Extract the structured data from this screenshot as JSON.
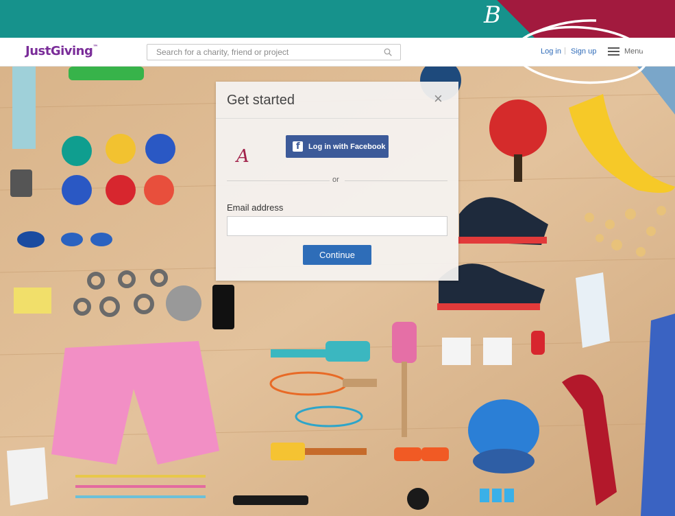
{
  "annotations": {
    "letter_b": "B",
    "letter_a": "A"
  },
  "header": {
    "logo": "JustGiving",
    "logo_tm": "™",
    "search_placeholder": "Search for a charity, friend or project",
    "login": "Log in",
    "separator": "|",
    "signup": "Sign up",
    "menu": "Menu"
  },
  "modal": {
    "title": "Get started",
    "close": "×",
    "facebook_button": "Log in with Facebook",
    "or": "or",
    "email_label": "Email address",
    "email_value": "",
    "continue_button": "Continue"
  },
  "colors": {
    "brand_purple": "#7a2d99",
    "link_blue": "#2d6ab8",
    "facebook_blue": "#3c5a99",
    "frame_teal": "#16928c",
    "frame_red": "#a21a3e"
  }
}
